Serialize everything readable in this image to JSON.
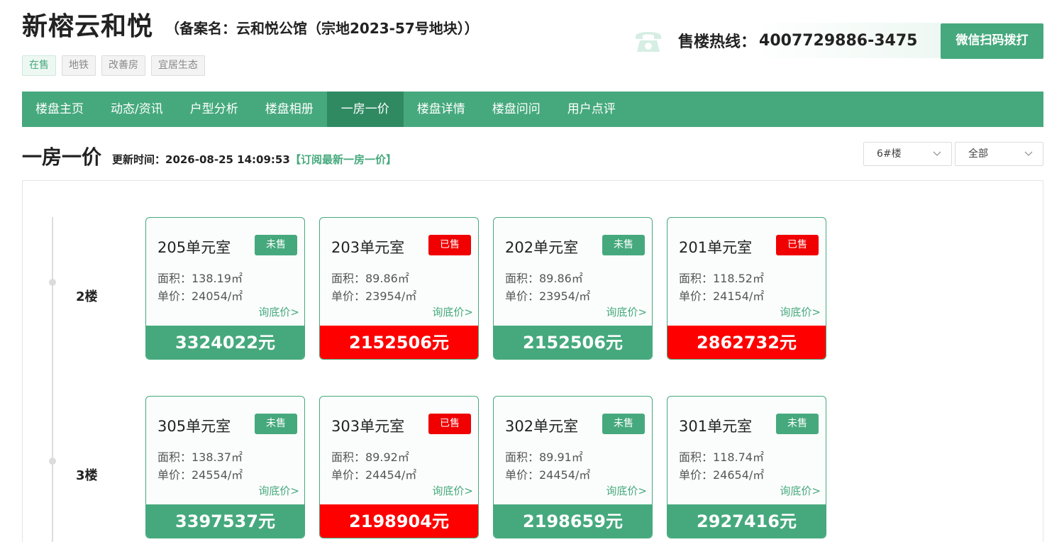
{
  "header": {
    "title": "新榕云和悦",
    "subtitle": "（备案名：云和悦公馆（宗地2023-57号地块））",
    "tags": [
      "在售",
      "地铁",
      "改善房",
      "宜居生态"
    ],
    "hotline_label": "售楼热线：",
    "hotline_number": "4007729886-3475",
    "wechat_button": "微信扫码拨打"
  },
  "nav": {
    "items": [
      "楼盘主页",
      "动态/资讯",
      "户型分析",
      "楼盘相册",
      "一房一价",
      "楼盘详情",
      "楼盘问问",
      "用户点评"
    ],
    "active": "一房一价"
  },
  "section": {
    "title": "一房一价",
    "update_time": "更新时间：2026-08-25 14:09:53",
    "subscribe": "【订阅最新一房一价】",
    "building_select": "6#楼",
    "filter_select": "全部"
  },
  "floors": [
    {
      "label": "2楼",
      "units": [
        {
          "name": "205单元室",
          "status": "未售",
          "area": "面积：138.19㎡",
          "unit_price": "单价：24054/㎡",
          "ask": "询底价>",
          "total": "3324022元",
          "sold": false
        },
        {
          "name": "203单元室",
          "status": "已售",
          "area": "面积：89.86㎡",
          "unit_price": "单价：23954/㎡",
          "ask": "询底价>",
          "total": "2152506元",
          "sold": true
        },
        {
          "name": "202单元室",
          "status": "未售",
          "area": "面积：89.86㎡",
          "unit_price": "单价：23954/㎡",
          "ask": "询底价>",
          "total": "2152506元",
          "sold": false
        },
        {
          "name": "201单元室",
          "status": "已售",
          "area": "面积：118.52㎡",
          "unit_price": "单价：24154/㎡",
          "ask": "询底价>",
          "total": "2862732元",
          "sold": true
        }
      ]
    },
    {
      "label": "3楼",
      "units": [
        {
          "name": "305单元室",
          "status": "未售",
          "area": "面积：138.37㎡",
          "unit_price": "单价：24554/㎡",
          "ask": "询底价>",
          "total": "3397537元",
          "sold": false
        },
        {
          "name": "303单元室",
          "status": "已售",
          "area": "面积：89.92㎡",
          "unit_price": "单价：24454/㎡",
          "ask": "询底价>",
          "total": "2198904元",
          "sold": true
        },
        {
          "name": "302单元室",
          "status": "未售",
          "area": "面积：89.91㎡",
          "unit_price": "单价：24454/㎡",
          "ask": "询底价>",
          "total": "2198659元",
          "sold": false
        },
        {
          "name": "301单元室",
          "status": "未售",
          "area": "面积：118.74㎡",
          "unit_price": "单价：24654/㎡",
          "ask": "询底价>",
          "total": "2927416元",
          "sold": false
        }
      ]
    }
  ],
  "colors": {
    "brand_green": "#46a97d",
    "nav_active": "#2f8a62",
    "sold_red": "#ff0000"
  },
  "icons": {
    "hotline": "phone-icon",
    "select": "chevron-down-icon"
  }
}
